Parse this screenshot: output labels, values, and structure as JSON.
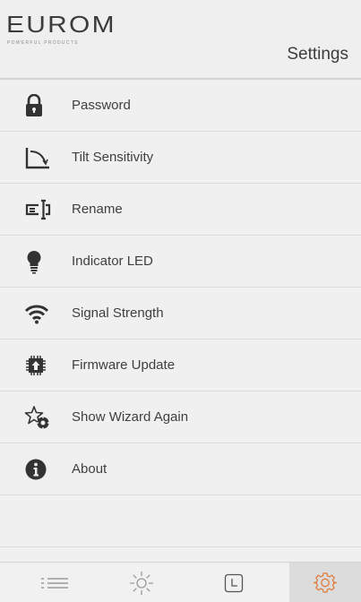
{
  "header": {
    "brand": "EUROM",
    "tagline": "POWERFUL PRODUCTS",
    "title": "Settings"
  },
  "menu": [
    {
      "label": "Password",
      "icon": "lock-icon"
    },
    {
      "label": "Tilt Sensitivity",
      "icon": "tilt-icon"
    },
    {
      "label": "Rename",
      "icon": "rename-icon"
    },
    {
      "label": "Indicator LED",
      "icon": "lightbulb-icon"
    },
    {
      "label": "Signal Strength",
      "icon": "wifi-icon"
    },
    {
      "label": "Firmware Update",
      "icon": "chip-icon"
    },
    {
      "label": "Show Wizard Again",
      "icon": "wizard-icon"
    },
    {
      "label": "About",
      "icon": "info-icon"
    }
  ],
  "tabs": [
    {
      "name": "list",
      "icon": "list-icon",
      "active": false
    },
    {
      "name": "light",
      "icon": "sun-icon",
      "active": false
    },
    {
      "name": "timer",
      "icon": "clock-icon",
      "active": false
    },
    {
      "name": "settings",
      "icon": "gear-icon",
      "active": true
    }
  ],
  "colors": {
    "background": "#f0f0f0",
    "divider": "#dcdcdc",
    "text": "#3f3f3f",
    "accent": "#e07a3a",
    "active_tab": "#dcdcdc"
  }
}
